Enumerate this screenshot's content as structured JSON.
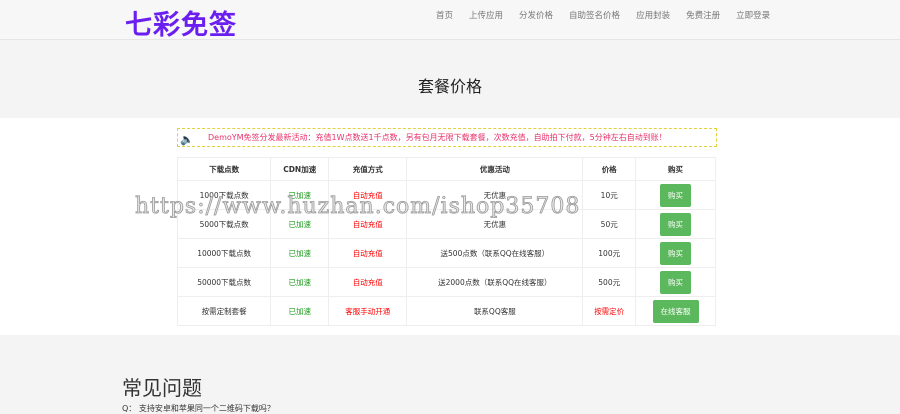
{
  "header": {
    "logo": "七彩免签",
    "nav": [
      "首页",
      "上传应用",
      "分发价格",
      "自助签名价格",
      "应用封装",
      "免费注册",
      "立即登录"
    ]
  },
  "page_title": "套餐价格",
  "notice": "DemoYM免签分发最新活动：充值1W点数送1千点数，另有包月无限下载套餐，次数充值，自助拍下付款，5分钟左右自动到账！",
  "table": {
    "headers": [
      "下载点数",
      "CDN加速",
      "充值方式",
      "优惠活动",
      "价格",
      "购买"
    ],
    "rows": [
      [
        "1000下载点数",
        "已加速",
        "自动充值",
        "无优惠",
        "10元",
        "购买"
      ],
      [
        "5000下载点数",
        "已加速",
        "自动充值",
        "无优惠",
        "50元",
        "购买"
      ],
      [
        "10000下载点数",
        "已加速",
        "自动充值",
        "送500点数（联系QQ在线客服）",
        "100元",
        "购买"
      ],
      [
        "50000下载点数",
        "已加速",
        "自动充值",
        "送2000点数（联系QQ在线客服）",
        "500元",
        "购买"
      ],
      [
        "按需定制套餐",
        "已加速",
        "客服手动开通",
        "联系QQ客服",
        "按需定价",
        "在线客服"
      ]
    ]
  },
  "watermark": "https://www.huzhan.com/ishop35708",
  "faq": {
    "title": "常见问题",
    "q1": "Q： 支持安卓和苹果同一个二维码下载吗？"
  }
}
